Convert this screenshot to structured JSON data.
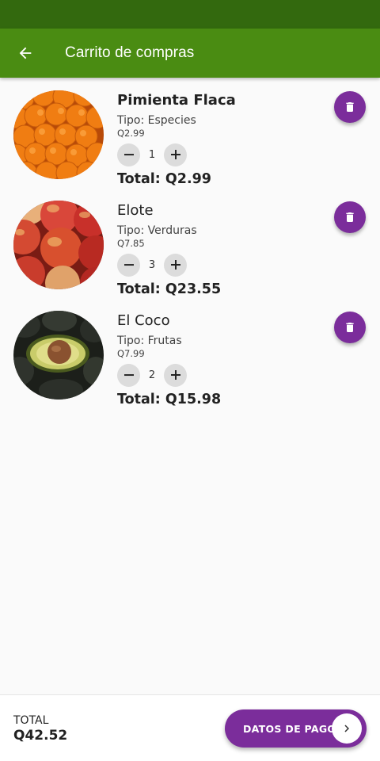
{
  "app_bar": {
    "title": "Carrito de compras",
    "back_icon": "arrow-left-icon"
  },
  "colors": {
    "status_bar": "#33690e",
    "app_bar": "#4a8c12",
    "accent": "#7b2d9b"
  },
  "cart": {
    "items": [
      {
        "name": "Pimienta Flaca",
        "tipo": "Tipo: Especies",
        "price": "Q2.99",
        "quantity": "1",
        "total": "Total: Q2.99",
        "image": "oranges"
      },
      {
        "name": "Elote",
        "tipo": "Tipo: Verduras",
        "price": "Q7.85",
        "quantity": "3",
        "total": "Total: Q23.55",
        "image": "apples"
      },
      {
        "name": "El Coco",
        "tipo": "Tipo: Frutas",
        "price": "Q7.99",
        "quantity": "2",
        "total": "Total: Q15.98",
        "image": "avocados"
      }
    ]
  },
  "footer": {
    "total_label": "TOTAL",
    "total_value": "Q42.52",
    "pay_button_label": "DATOS DE PAGO",
    "pay_icon": "chevron-right-icon"
  }
}
